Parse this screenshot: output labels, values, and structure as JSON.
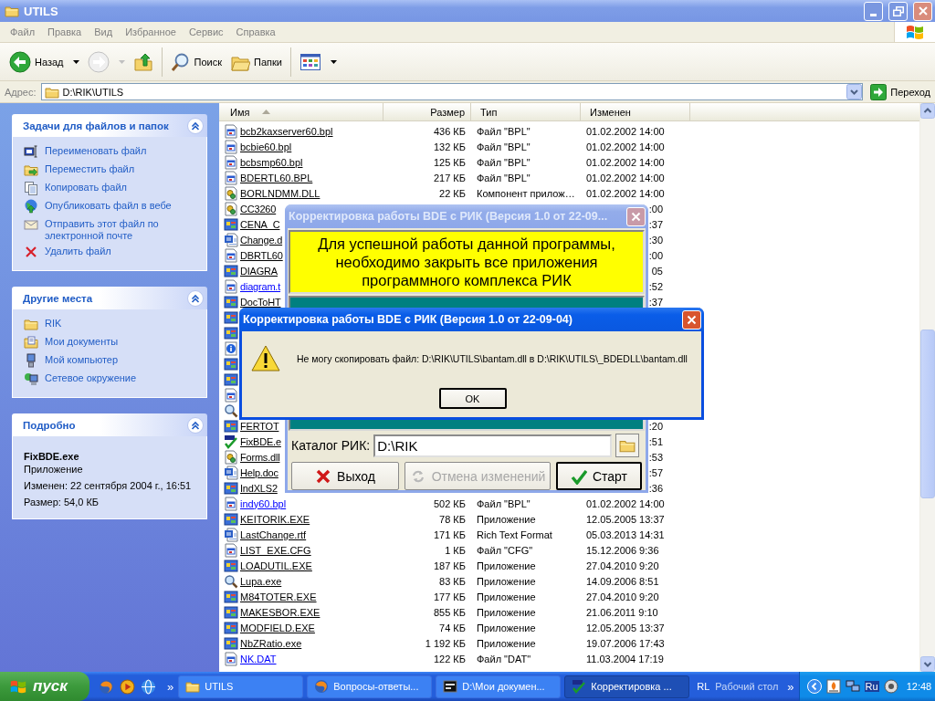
{
  "window": {
    "title": "UTILS",
    "active": false
  },
  "menu": [
    "Файл",
    "Правка",
    "Вид",
    "Избранное",
    "Сервис",
    "Справка"
  ],
  "toolbar": [
    {
      "kind": "back",
      "label": "Назад",
      "disabled": false,
      "dropdown": true
    },
    {
      "kind": "forward",
      "disabled": true,
      "dropdown": true
    },
    {
      "kind": "up",
      "disabled": false,
      "dropdown": false
    },
    {
      "kind": "separator"
    },
    {
      "kind": "search",
      "label": "Поиск",
      "disabled": false,
      "dropdown": false
    },
    {
      "kind": "folders",
      "label": "Папки",
      "disabled": false,
      "dropdown": false
    },
    {
      "kind": "separator"
    },
    {
      "kind": "views",
      "disabled": false,
      "dropdown": true
    }
  ],
  "address": {
    "label": "Адрес:",
    "value": "D:\\RIK\\UTILS",
    "go_label": "Переход"
  },
  "sidebar": {
    "panels": [
      {
        "kind": "links",
        "title": "Задачи для файлов и папок",
        "expanded": true,
        "items": [
          {
            "label": "Переименовать файл"
          },
          {
            "label": "Переместить файл"
          },
          {
            "label": "Копировать файл"
          },
          {
            "label": "Опубликовать файл в вебе"
          },
          {
            "label": "Отправить этот файл по электронной почте"
          },
          {
            "label": "Удалить файл"
          }
        ]
      },
      {
        "kind": "links",
        "title": "Другие места",
        "expanded": true,
        "items": [
          {
            "label": "RIK"
          },
          {
            "label": "Мои документы"
          },
          {
            "label": "Мой компьютер"
          },
          {
            "label": "Сетевое окружение"
          }
        ]
      },
      {
        "kind": "details",
        "title": "Подробно",
        "expanded": true,
        "name": "FixBDE.exe",
        "type": "Приложение",
        "modified": "Изменен: 22 сентября 2004 г., 16:51",
        "size": "Размер: 54,0 КБ"
      }
    ]
  },
  "file_list": {
    "columns": [
      {
        "label": "Имя",
        "sorted": true
      },
      {
        "label": "Размер",
        "sorted": false
      },
      {
        "label": "Тип",
        "sorted": false
      },
      {
        "label": "Изменен",
        "sorted": false
      }
    ],
    "rows": [
      {
        "kind": "full",
        "name": "bcb2kaxserver60.bpl",
        "size": "436 КБ",
        "type": "Файл \"BPL\"",
        "modified": "01.02.2002 14:00",
        "hot": false
      },
      {
        "kind": "full",
        "name": "bcbie60.bpl",
        "size": "132 КБ",
        "type": "Файл \"BPL\"",
        "modified": "01.02.2002 14:00",
        "hot": false
      },
      {
        "kind": "full",
        "name": "bcbsmp60.bpl",
        "size": "125 КБ",
        "type": "Файл \"BPL\"",
        "modified": "01.02.2002 14:00",
        "hot": false
      },
      {
        "kind": "full",
        "name": "BDERTL60.BPL",
        "size": "217 КБ",
        "type": "Файл \"BPL\"",
        "modified": "01.02.2002 14:00",
        "hot": false
      },
      {
        "kind": "full",
        "name": "BORLNDMM.DLL",
        "size": "22 КБ",
        "type": "Компонент прилож…",
        "modified": "01.02.2002 14:00",
        "hot": false
      },
      {
        "kind": "partial",
        "name": "CC3260",
        "modified": ":00",
        "hot": false
      },
      {
        "kind": "partial",
        "name": "CENA_C",
        "modified": ":37",
        "hot": false
      },
      {
        "kind": "partial",
        "name": "Change.d",
        "modified": ":30",
        "hot": false
      },
      {
        "kind": "partial",
        "name": "DBRTL60",
        "modified": ":00",
        "hot": false
      },
      {
        "kind": "partial",
        "name": "DIAGRA",
        "modified": "05",
        "hot": false
      },
      {
        "kind": "partial",
        "name": "diagram.t",
        "modified": ":52",
        "hot": true
      },
      {
        "kind": "partial",
        "name": "DocToHT",
        "modified": ":37",
        "hot": false
      },
      {
        "kind": "icon"
      },
      {
        "kind": "icon"
      },
      {
        "kind": "icon"
      },
      {
        "kind": "icon"
      },
      {
        "kind": "icon"
      },
      {
        "kind": "icon"
      },
      {
        "kind": "icon"
      },
      {
        "kind": "partial",
        "name": "FERTOT",
        "modified": ":20",
        "hot": false
      },
      {
        "kind": "partial",
        "name": "FixBDE.e",
        "modified": ":51",
        "hot": false
      },
      {
        "kind": "partial",
        "name": "Forms.dll",
        "modified": ":53",
        "hot": false
      },
      {
        "kind": "partial",
        "name": "Help.doc",
        "modified": ":57",
        "hot": false
      },
      {
        "kind": "partial",
        "name": "IndXLS2",
        "modified": ":36",
        "hot": false
      },
      {
        "kind": "full",
        "name": "indy60.bpl",
        "size": "502 КБ",
        "type": "Файл \"BPL\"",
        "modified": "01.02.2002 14:00",
        "hot": true
      },
      {
        "kind": "full",
        "name": "KEITORIK.EXE",
        "size": "78 КБ",
        "type": "Приложение",
        "modified": "12.05.2005 13:37",
        "hot": false
      },
      {
        "kind": "full",
        "name": "LastChange.rtf",
        "size": "171 КБ",
        "type": "Rich Text Format",
        "modified": "05.03.2013 14:31",
        "hot": false
      },
      {
        "kind": "full",
        "name": "LIST_EXE.CFG",
        "size": "1 КБ",
        "type": "Файл \"CFG\"",
        "modified": "15.12.2006 9:36",
        "hot": false
      },
      {
        "kind": "full",
        "name": "LOADUTIL.EXE",
        "size": "187 КБ",
        "type": "Приложение",
        "modified": "27.04.2010 9:20",
        "hot": false
      },
      {
        "kind": "full",
        "name": "Lupa.exe",
        "size": "83 КБ",
        "type": "Приложение",
        "modified": "14.09.2006 8:51",
        "hot": false
      },
      {
        "kind": "full",
        "name": "M84TOTER.EXE",
        "size": "177 КБ",
        "type": "Приложение",
        "modified": "27.04.2010 9:20",
        "hot": false
      },
      {
        "kind": "full",
        "name": "MAKESBOR.EXE",
        "size": "855 КБ",
        "type": "Приложение",
        "modified": "21.06.2011 9:10",
        "hot": false
      },
      {
        "kind": "full",
        "name": "MODFIELD.EXE",
        "size": "74 КБ",
        "type": "Приложение",
        "modified": "12.05.2005 13:37",
        "hot": false
      },
      {
        "kind": "full",
        "name": "NbZRatio.exe",
        "size": "1 192 КБ",
        "type": "Приложение",
        "modified": "19.07.2006 17:43",
        "hot": false
      },
      {
        "kind": "full",
        "name": "NK.DAT",
        "size": "122 КБ",
        "type": "Файл \"DAT\"",
        "modified": "11.03.2004 17:19",
        "hot": true
      }
    ]
  },
  "dialogs": [
    {
      "kind": "form",
      "title": "Корректировка работы BDE с РИК (Версия 1.0 от 22-09...",
      "active": false,
      "notice": "Для успешной работы данной программы,\nнеобходимо закрыть все приложения\nпрограммного комплекса РИК",
      "folder_label": "Каталог РИК:",
      "folder_value": "D:\\RIK",
      "buttons": [
        {
          "kind": "exit",
          "label": "Выход",
          "disabled": false,
          "default": false
        },
        {
          "kind": "undo",
          "label": "Отмена изменений",
          "disabled": true,
          "default": false
        },
        {
          "kind": "start",
          "label": "Старт",
          "disabled": false,
          "default": true
        }
      ]
    },
    {
      "kind": "message",
      "title": "Корректировка работы BDE с РИК (Версия 1.0 от 22-09-04)",
      "active": true,
      "message": "Не могу скопировать файл: D:\\RIK\\UTILS\\bantam.dll в D:\\RIK\\UTILS\\_BDEDLL\\bantam.dll",
      "buttons": [
        {
          "kind": "ok",
          "label": "OK",
          "disabled": false,
          "default": true
        }
      ]
    }
  ],
  "taskbar": {
    "start": "пуск",
    "quick_more": "»",
    "tasks": [
      {
        "label": "UTILS",
        "selected": false
      },
      {
        "label": "Вопросы-ответы...",
        "selected": false
      },
      {
        "label": "D:\\Мои докумен...",
        "selected": false
      },
      {
        "label": "Корректировка ...",
        "selected": true
      }
    ],
    "toolbars": [
      {
        "label": "RL"
      },
      {
        "label": "Рабочий стол"
      }
    ],
    "toolbars_more": "»",
    "tray": {
      "items": [
        {
          "kind": "expand"
        },
        {
          "kind": "app"
        },
        {
          "kind": "network"
        },
        {
          "kind": "language",
          "label": "Ru"
        },
        {
          "kind": "media"
        }
      ],
      "clock": "12:48"
    }
  }
}
